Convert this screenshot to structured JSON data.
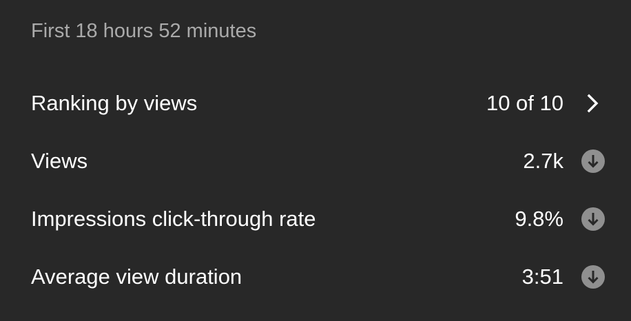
{
  "period_label": "First 18 hours 52 minutes",
  "metrics": [
    {
      "label": "Ranking by views",
      "value": "10 of 10",
      "icon": "chevron-right-icon"
    },
    {
      "label": "Views",
      "value": "2.7k",
      "icon": "arrow-down-circle-icon"
    },
    {
      "label": "Impressions click-through rate",
      "value": "9.8%",
      "icon": "arrow-down-circle-icon"
    },
    {
      "label": "Average view duration",
      "value": "3:51",
      "icon": "arrow-down-circle-icon"
    }
  ],
  "colors": {
    "background": "#282828",
    "primary_text": "#ffffff",
    "secondary_text": "#aaaaaa",
    "indicator": "#909090"
  }
}
